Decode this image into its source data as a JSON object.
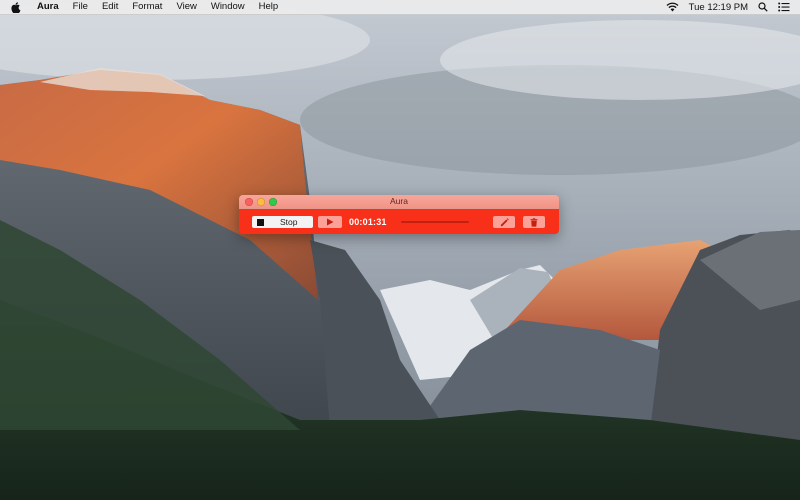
{
  "menubar": {
    "app_name": "Aura",
    "items": [
      "File",
      "Edit",
      "Format",
      "View",
      "Window",
      "Help"
    ],
    "clock": "Tue 12:19 PM",
    "icons": [
      "apple-icon",
      "wifi-icon",
      "spotlight-search-icon",
      "notification-center-icon"
    ]
  },
  "aura_window": {
    "title": "Aura",
    "stop_label": "Stop",
    "elapsed_time": "00:01:31",
    "icons": {
      "stop": "stop-square-icon",
      "play": "play-icon",
      "edit": "pencil-icon",
      "delete": "trash-icon"
    },
    "accent_color": "#f8301a",
    "titlebar_color": "#f29487"
  }
}
